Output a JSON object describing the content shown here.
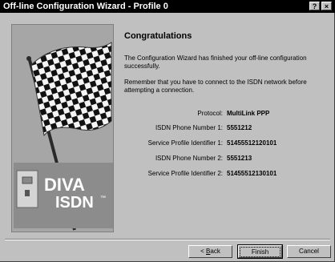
{
  "window": {
    "title": "Off-line Configuration Wizard - Profile 0",
    "help_glyph": "?",
    "close_glyph": "×"
  },
  "logo": {
    "text_line1": "DIVA",
    "text_line2": "ISDN",
    "trademark": "™"
  },
  "content": {
    "heading": "Congratulations",
    "paragraph1": "The Configuration Wizard has finished your off-line configuration successfully.",
    "paragraph2": "Remember that you have to connect to the ISDN network before attempting a connection."
  },
  "summary": [
    {
      "label": "Protocol:",
      "value": "MultiLink PPP"
    },
    {
      "label": "ISDN Phone Number 1:",
      "value": "5551212"
    },
    {
      "label": "Service Profile Identifier 1:",
      "value": "51455512120101"
    },
    {
      "label": "ISDN Phone Number 2:",
      "value": "5551213"
    },
    {
      "label": "Service Profile Identifier 2:",
      "value": "51455512130101"
    }
  ],
  "buttons": {
    "back_prefix": "< ",
    "back_accel": "B",
    "back_rest": "ack",
    "finish": "Finish",
    "cancel": "Cancel"
  }
}
